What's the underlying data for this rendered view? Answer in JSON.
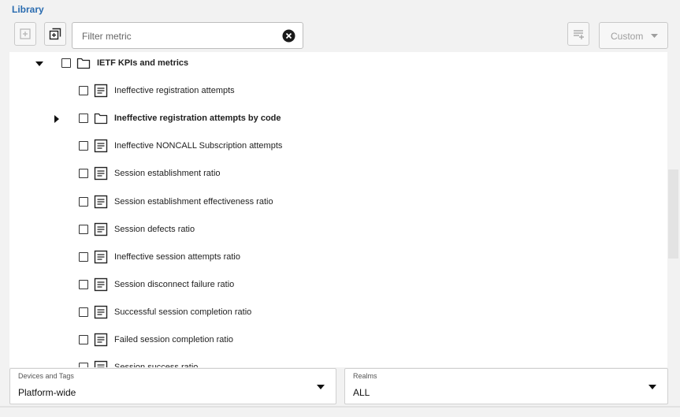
{
  "panel": {
    "title": "Library"
  },
  "toolbar": {
    "add_button_icon": "plus-square-icon",
    "add_child_button_icon": "copy-add-icon",
    "search": {
      "placeholder": "Filter metric",
      "value": ""
    },
    "clear_icon": "clear-circle-icon",
    "list_add_icon": "list-add-icon",
    "custom_label": "Custom"
  },
  "tree": {
    "items": [
      {
        "label": "IETF KPIs and metrics",
        "type": "folder",
        "level": 0,
        "expanded": true,
        "bold": true
      },
      {
        "label": "Ineffective registration attempts",
        "type": "metric",
        "level": 1
      },
      {
        "label": "Ineffective registration attempts by code",
        "type": "folder",
        "level": 1,
        "expanded": false,
        "bold": true
      },
      {
        "label": "Ineffective NONCALL Subscription attempts",
        "type": "metric",
        "level": 1
      },
      {
        "label": "Session establishment ratio",
        "type": "metric",
        "level": 1
      },
      {
        "label": "Session establishment effectiveness ratio",
        "type": "metric",
        "level": 1
      },
      {
        "label": "Session defects ratio",
        "type": "metric",
        "level": 1
      },
      {
        "label": "Ineffective session attempts ratio",
        "type": "metric",
        "level": 1
      },
      {
        "label": "Session disconnect failure ratio",
        "type": "metric",
        "level": 1
      },
      {
        "label": "Successful session completion ratio",
        "type": "metric",
        "level": 1
      },
      {
        "label": "Failed session completion ratio",
        "type": "metric",
        "level": 1
      },
      {
        "label": "Session success ratio",
        "type": "metric",
        "level": 1
      }
    ]
  },
  "filters": {
    "devices": {
      "label": "Devices and Tags",
      "value": "Platform-wide"
    },
    "realms": {
      "label": "Realms",
      "value": "ALL"
    }
  },
  "colors": {
    "accent": "#2a6cb0",
    "border": "#c9c9c9",
    "background": "#f2f2f2"
  }
}
